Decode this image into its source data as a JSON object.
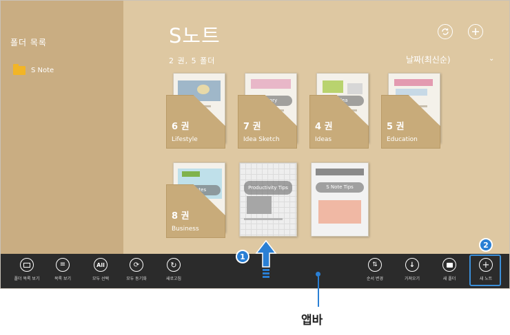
{
  "sidebar": {
    "title": "폴더 목록",
    "folder": "S Note"
  },
  "header": {
    "title": "S노트",
    "subtitle": "2 권, 5 폴더",
    "sort": "날짜(최신순)"
  },
  "folders": [
    {
      "count": "6 권",
      "name": "Lifestyle",
      "preview": ""
    },
    {
      "count": "7 권",
      "name": "Idea Sketch",
      "preview": "Story"
    },
    {
      "count": "4 권",
      "name": "Ideas",
      "preview": "Idea"
    },
    {
      "count": "5 권",
      "name": "Education",
      "preview": ""
    },
    {
      "count": "8 권",
      "name": "Business",
      "preview": "Notes"
    }
  ],
  "notes": [
    {
      "preview": "Productivity Tips"
    },
    {
      "preview": "S Note Tips"
    }
  ],
  "appbar": {
    "buttons": [
      {
        "label": "폴더 목록 보기",
        "icon": "folder-list-icon"
      },
      {
        "label": "목록 보기",
        "icon": "list-view-icon"
      },
      {
        "label": "모두 선택",
        "icon": "select-all-icon"
      },
      {
        "label": "모두 동기화",
        "icon": "sync-all-icon"
      },
      {
        "label": "새로고침",
        "icon": "refresh-icon"
      },
      {
        "label": "순서 변경",
        "icon": "reorder-icon"
      },
      {
        "label": "가져오기",
        "icon": "import-icon"
      },
      {
        "label": "새 폴더",
        "icon": "new-folder-icon"
      },
      {
        "label": "새 노트",
        "icon": "new-note-icon"
      }
    ]
  },
  "annotations": {
    "badge1": "1",
    "badge2": "2",
    "callout": "앱바"
  },
  "colors": {
    "sidebar": "#c9ad82",
    "main": "#dec8a2",
    "appbar": "#2b2b2b",
    "accent": "#2a7fd4"
  }
}
